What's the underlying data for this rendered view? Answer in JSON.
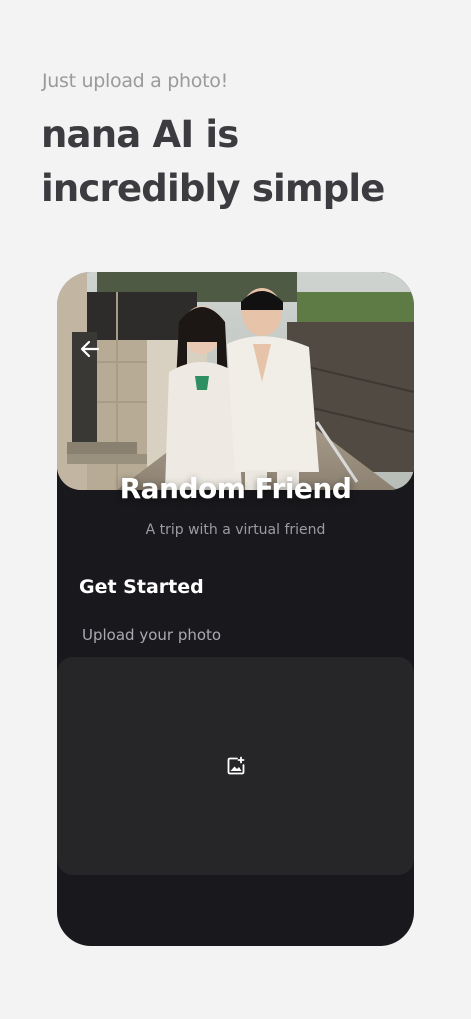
{
  "promo": {
    "eyebrow": "Just upload a photo!",
    "headline": "nana AI is incredibly simple"
  },
  "screen": {
    "title": "Random Friend",
    "subtitle": "A trip with a virtual friend",
    "section_title": "Get Started",
    "upload_label": "Upload your photo"
  },
  "icons": {
    "back": "arrow-left-icon",
    "upload": "add-image-icon"
  },
  "colors": {
    "page_background": "#f3f3f3",
    "phone_background": "#19191d",
    "upload_box": "#262629",
    "headline": "#3b3b40"
  }
}
